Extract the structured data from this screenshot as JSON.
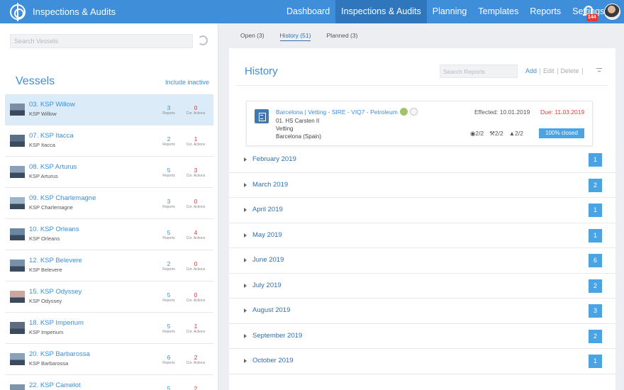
{
  "app": {
    "title": "Inspections & Audits"
  },
  "nav": {
    "items": [
      {
        "label": "Dashboard",
        "active": false
      },
      {
        "label": "Inspections & Audits",
        "active": true
      },
      {
        "label": "Planning",
        "active": false
      },
      {
        "label": "Templates",
        "active": false
      },
      {
        "label": "Reports",
        "active": false
      },
      {
        "label": "Settings",
        "active": false
      }
    ],
    "notification_count": "144",
    "icons": [
      "logo-icon",
      "bell-icon",
      "avatar"
    ]
  },
  "vessels_panel": {
    "search_placeholder": "Search Vessels",
    "title": "Vessels",
    "include_inactive": "Include inactive",
    "reports_label": "Reports",
    "cor_label": "Cor. Actions",
    "items": [
      {
        "name": "03. KSP Willow",
        "sub": "KSP Willow",
        "reports": "3",
        "cor": "0",
        "selected": true
      },
      {
        "name": "07. KSP Itacca",
        "sub": "KSP Itacca",
        "reports": "2",
        "cor": "1"
      },
      {
        "name": "08. KSP Arturus",
        "sub": "KSP Arturus",
        "reports": "5",
        "cor": "3"
      },
      {
        "name": "09. KSP Charlemagne",
        "sub": "KSP Charlemagne",
        "reports": "3",
        "cor": "0"
      },
      {
        "name": "10. KSP Orleans",
        "sub": "KSP Orleans",
        "reports": "5",
        "cor": "4"
      },
      {
        "name": "12. KSP Belevere",
        "sub": "KSP Belevere",
        "reports": "2",
        "cor": "0"
      },
      {
        "name": "15. KSP Odyssey",
        "sub": "KSP Odyssey",
        "reports": "5",
        "cor": "0"
      },
      {
        "name": "18. KSP Imperium",
        "sub": "KSP Imperium",
        "reports": "5",
        "cor": "1"
      },
      {
        "name": "20. KSP Barbarossa",
        "sub": "KSP Barbarossa",
        "reports": "6",
        "cor": "2"
      },
      {
        "name": "22. KSP Camelot",
        "sub": "",
        "reports": "5",
        "cor": "2"
      }
    ]
  },
  "tabs": [
    {
      "label": "Open (3)",
      "active": false
    },
    {
      "label": "History (51)",
      "active": true
    },
    {
      "label": "Planned (3)",
      "active": false
    }
  ],
  "history": {
    "title": "History",
    "search_placeholder": "Search Reports",
    "add": "Add",
    "edit": "Edit",
    "delete": "Delete",
    "report": {
      "title": "Barcelona | Vetting - SIRE - VIQ7 - Petroleum",
      "inspector": "01. HS Carsten II",
      "type": "Vetting",
      "location": "Barcelona (Spain)",
      "effected": "Effected: 10.01.2019",
      "due": "Due: 11.03.2019",
      "views": "2/2",
      "actions": "2/2",
      "people": "2/2",
      "status": "100% closed"
    },
    "months": [
      {
        "label": "February 2019",
        "count": "1"
      },
      {
        "label": "March 2019",
        "count": "2"
      },
      {
        "label": "April 2019",
        "count": "1"
      },
      {
        "label": "May 2019",
        "count": "1"
      },
      {
        "label": "June 2019",
        "count": "6"
      },
      {
        "label": "July 2019",
        "count": "2"
      },
      {
        "label": "August 2019",
        "count": "3"
      },
      {
        "label": "September 2019",
        "count": "2"
      },
      {
        "label": "October 2019",
        "count": "1"
      }
    ]
  }
}
